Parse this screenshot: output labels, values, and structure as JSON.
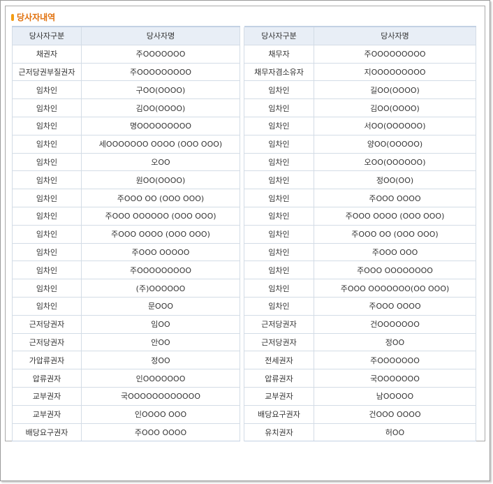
{
  "section": {
    "title": "당사자내역"
  },
  "table": {
    "headers": [
      "당사자구분",
      "당사자명",
      "당사자구분",
      "당사자명"
    ],
    "rows": [
      [
        "채권자",
        "주OOOOOOO",
        "채무자",
        "주OOOOOOOOO"
      ],
      [
        "근저당권부질권자",
        "주OOOOOOOOO",
        "채무자겸소유자",
        "지OOOOOOOOO"
      ],
      [
        "임차인",
        "구OO(OOOO)",
        "임차인",
        "길OO(OOOO)"
      ],
      [
        "임차인",
        "김OO(OOOO)",
        "임차인",
        "김OO(OOOO)"
      ],
      [
        "임차인",
        "명OOOOOOOOO",
        "임차인",
        "서OO(OOOOOO)"
      ],
      [
        "임차인",
        "세OOOOOOO OOOO (OOO OOO)",
        "임차인",
        "양OO(OOOOO)"
      ],
      [
        "임차인",
        "오OO",
        "임차인",
        "오OO(OOOOOO)"
      ],
      [
        "임차인",
        "원OO(OOOO)",
        "임차인",
        "정OO(OO)"
      ],
      [
        "임차인",
        "주OOO OO (OOO OOO)",
        "임차인",
        "주OOO OOOO"
      ],
      [
        "임차인",
        "주OOO OOOOOO (OOO OOO)",
        "임차인",
        "주OOO OOOO (OOO OOO)"
      ],
      [
        "임차인",
        "주OOO OOOO (OOO OOO)",
        "임차인",
        "주OOO OO (OOO OOO)"
      ],
      [
        "임차인",
        "주OOO OOOOO",
        "임차인",
        "주OOO OOO"
      ],
      [
        "임차인",
        "주OOOOOOOOO",
        "임차인",
        "주OOO OOOOOOOO"
      ],
      [
        "임차인",
        "(주)OOOOOO",
        "임차인",
        "주OOO OOOOOOO(OO OOO)"
      ],
      [
        "임차인",
        "문OOO",
        "임차인",
        "주OOO OOOO"
      ],
      [
        "근저당권자",
        "임OO",
        "근저당권자",
        "건OOOOOOO"
      ],
      [
        "근저당권자",
        "안OO",
        "근저당권자",
        "정OO"
      ],
      [
        "가압류권자",
        "정OO",
        "전세권자",
        "주OOOOOOO"
      ],
      [
        "압류권자",
        "인OOOOOOO",
        "압류권자",
        "국OOOOOOO"
      ],
      [
        "교부권자",
        "국OOOOOOOOOOOO",
        "교부권자",
        "남OOOOO"
      ],
      [
        "교부권자",
        "인OOOO OOO",
        "배당요구권자",
        "건OOO OOOO"
      ],
      [
        "배당요구권자",
        "주OOO OOOO",
        "유치권자",
        "허OO"
      ]
    ]
  }
}
